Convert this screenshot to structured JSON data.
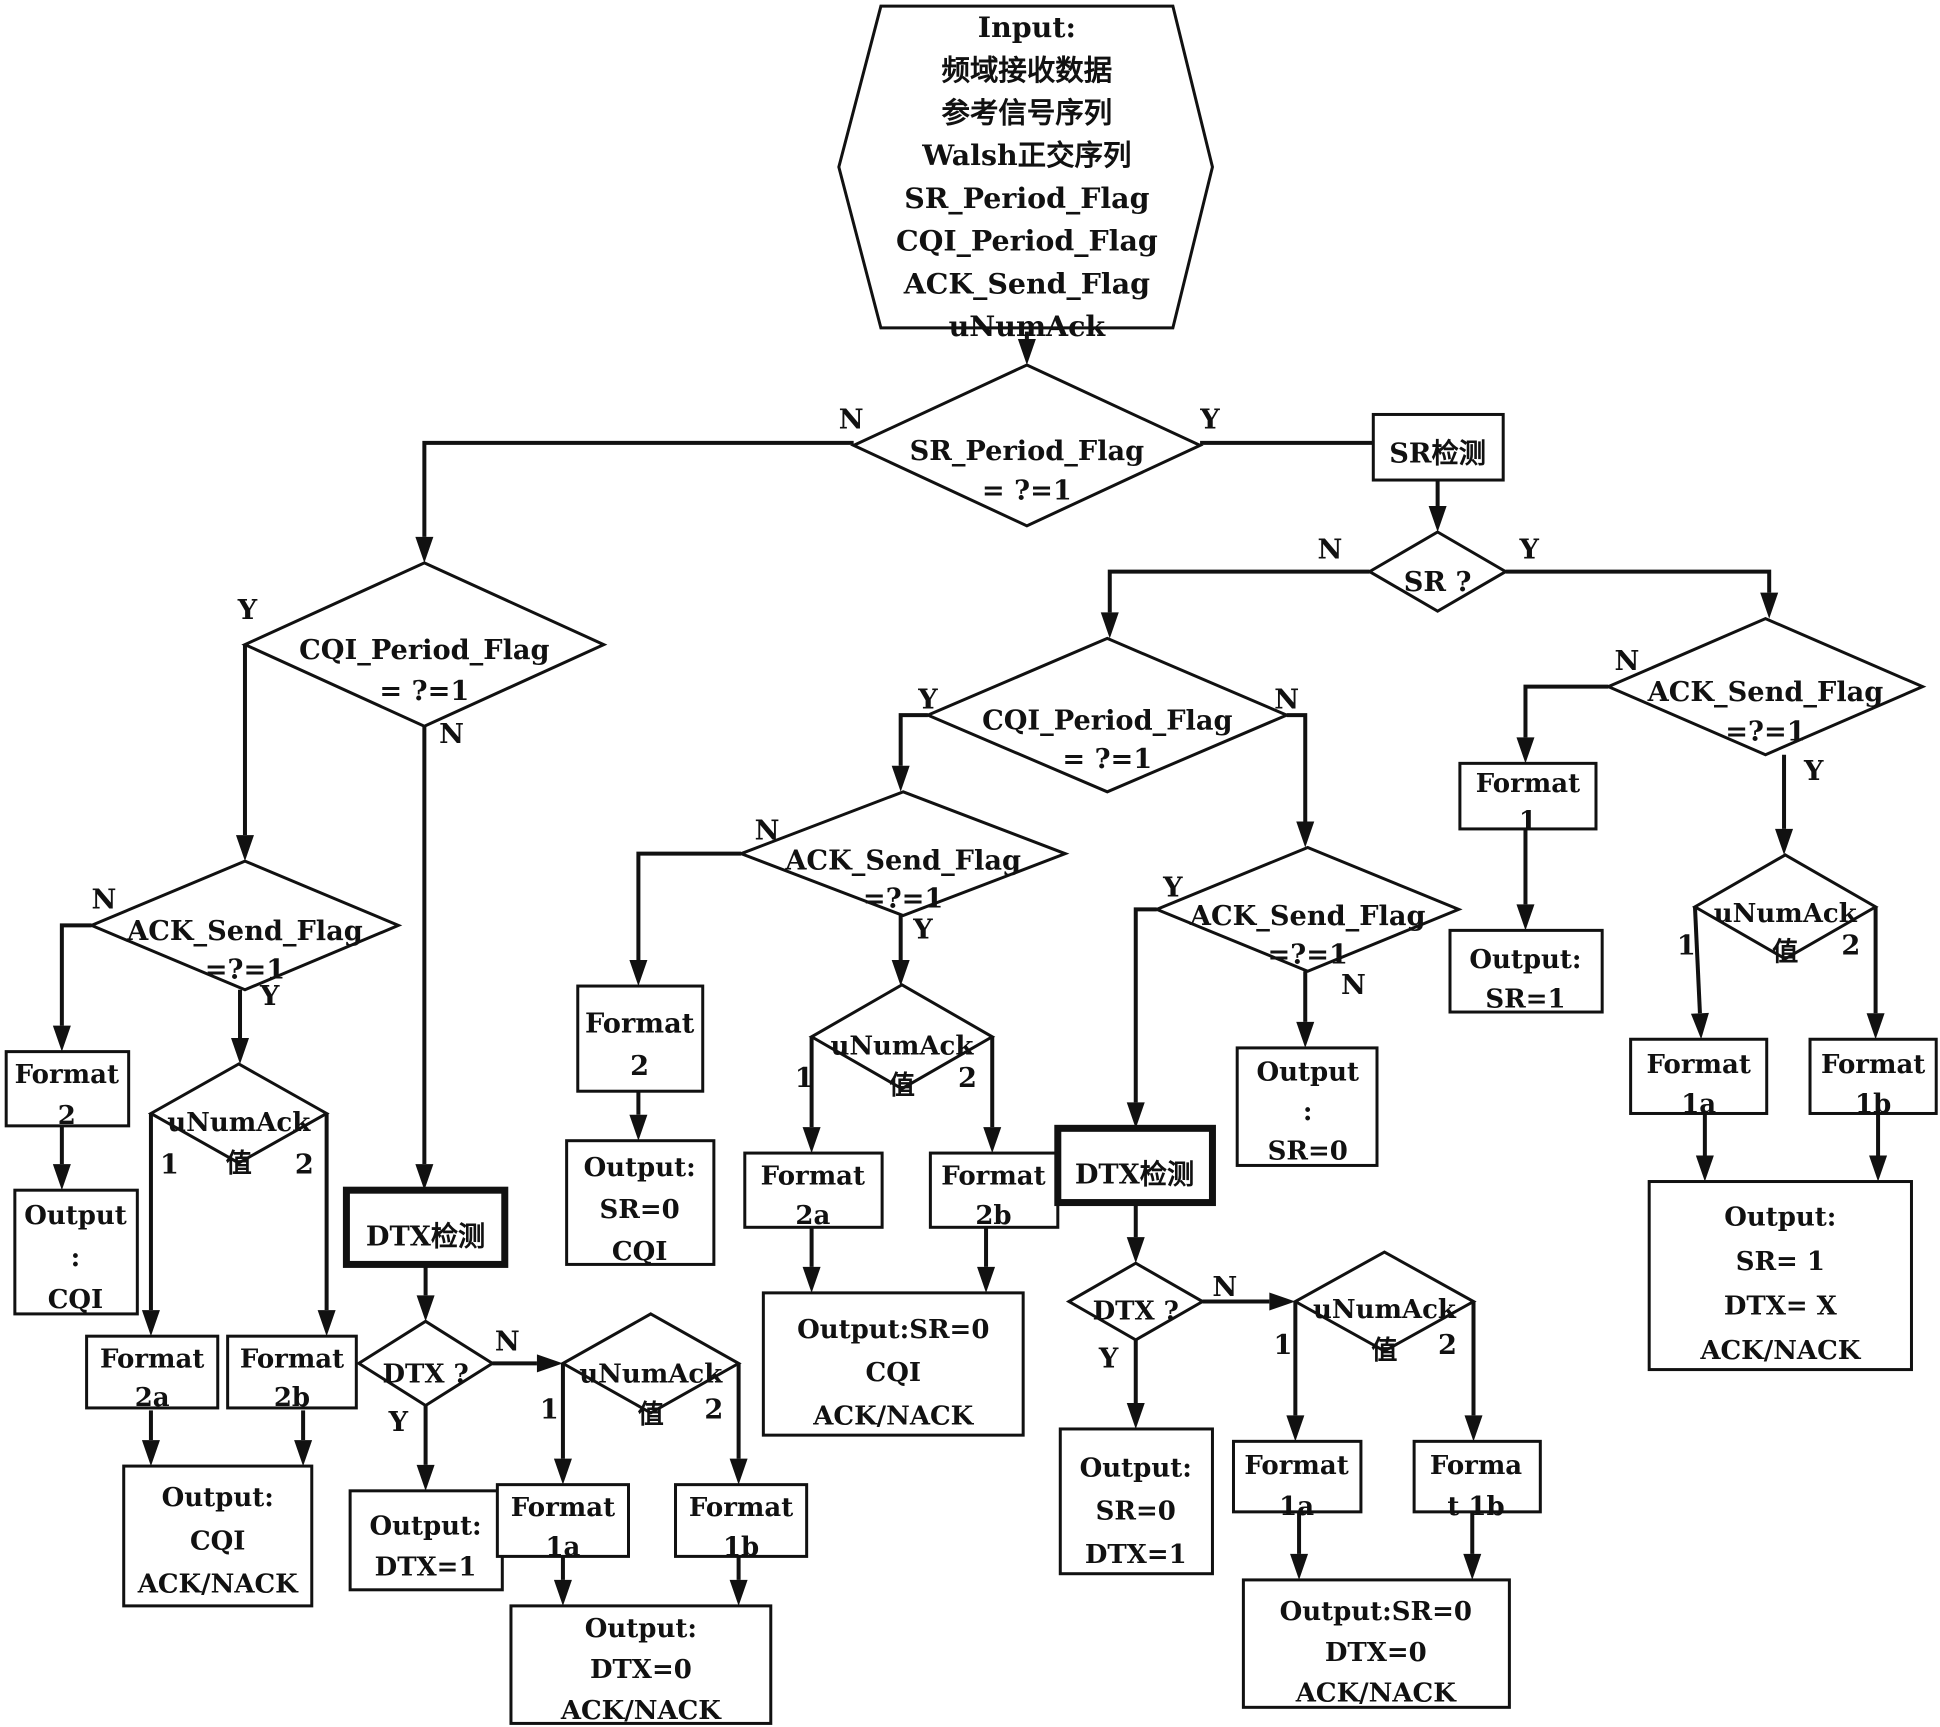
{
  "diagram": {
    "type": "flowchart",
    "language": "zh/en",
    "colors": {
      "ink": "#111111",
      "background": "#ffffff"
    },
    "nodes": {
      "input": {
        "shape": "hexagon",
        "lines": [
          "Input:",
          "频域接收数据",
          "参考信号序列",
          "Walsh正交序列",
          "SR_Period_Flag",
          "CQI_Period_Flag",
          "ACK_Send_Flag",
          "uNumAck"
        ]
      },
      "sr_period_decision": {
        "shape": "decision",
        "lines": [
          "SR_Period_Flag",
          "= ?=1"
        ]
      },
      "sr_detect": {
        "shape": "process",
        "lines": [
          "SR检测"
        ]
      },
      "sr_decision": {
        "shape": "decision",
        "lines": [
          "SR ?"
        ]
      },
      "cqi_decision_left": {
        "shape": "decision",
        "lines": [
          "CQI_Period_Flag",
          "= ?=1"
        ]
      },
      "ack_decision_left": {
        "shape": "decision",
        "lines": [
          "ACK_Send_Flag",
          "=?=1"
        ]
      },
      "format2_left": {
        "shape": "process",
        "lines": [
          "Format",
          "2"
        ]
      },
      "output_cqi_left": {
        "shape": "process",
        "lines": [
          "Output",
          ":",
          "CQI"
        ]
      },
      "unumack_left": {
        "shape": "decision",
        "lines": [
          "uNumAck",
          "值"
        ]
      },
      "format2a_left": {
        "shape": "process",
        "lines": [
          "Format",
          "2a"
        ]
      },
      "format2b_left": {
        "shape": "process",
        "lines": [
          "Format",
          "2b"
        ]
      },
      "output_cqi_acknack_left": {
        "shape": "process",
        "lines": [
          "Output:",
          "CQI",
          "ACK/NACK"
        ]
      },
      "dtx_detect_left": {
        "shape": "process-bold",
        "lines": [
          "DTX检测"
        ]
      },
      "dtx_decision_left": {
        "shape": "decision",
        "lines": [
          "DTX ?"
        ]
      },
      "output_dtx1_left": {
        "shape": "process",
        "lines": [
          "Output:",
          "DTX=1"
        ]
      },
      "unumack_left2": {
        "shape": "decision",
        "lines": [
          "uNumAck",
          "值"
        ]
      },
      "format1a_left": {
        "shape": "process",
        "lines": [
          "Format",
          "1a"
        ]
      },
      "format1b_left": {
        "shape": "process",
        "lines": [
          "Format",
          "1b"
        ]
      },
      "output_dtx0_left": {
        "shape": "process",
        "lines": [
          "Output:",
          "DTX=0",
          "ACK/NACK"
        ]
      },
      "cqi_decision_mid": {
        "shape": "decision",
        "lines": [
          "CQI_Period_Flag",
          "= ?=1"
        ]
      },
      "ack_decision_mid": {
        "shape": "decision",
        "lines": [
          "ACK_Send_Flag",
          "=?=1"
        ]
      },
      "format2_mid": {
        "shape": "process",
        "lines": [
          "Format",
          "2"
        ]
      },
      "output_sr0_cqi_mid": {
        "shape": "process",
        "lines": [
          "Output:",
          "SR=0",
          "CQI"
        ]
      },
      "unumack_mid": {
        "shape": "decision",
        "lines": [
          "uNumAck",
          "值"
        ]
      },
      "format2a_mid": {
        "shape": "process",
        "lines": [
          "Format",
          "2a"
        ]
      },
      "format2b_mid": {
        "shape": "process",
        "lines": [
          "Format",
          "2b"
        ]
      },
      "output_sr0_cqi_acknack_mid": {
        "shape": "process",
        "lines": [
          "Output:SR=0",
          "CQI",
          "ACK/NACK"
        ]
      },
      "ack_decision_mid2": {
        "shape": "decision",
        "lines": [
          "ACK_Send_Flag",
          "=?=1"
        ]
      },
      "output_sr0_mid": {
        "shape": "process",
        "lines": [
          "Output",
          ":",
          "SR=0"
        ]
      },
      "dtx_detect_mid": {
        "shape": "process-bold",
        "lines": [
          "DTX检测"
        ]
      },
      "dtx_decision_mid": {
        "shape": "decision",
        "lines": [
          "DTX ?"
        ]
      },
      "output_sr0_dtx1_mid": {
        "shape": "process",
        "lines": [
          "Output:",
          "SR=0",
          "DTX=1"
        ]
      },
      "unumack_mid2": {
        "shape": "decision",
        "lines": [
          "uNumAck",
          "值"
        ]
      },
      "format1a_mid": {
        "shape": "process",
        "lines": [
          "Format",
          "1a"
        ]
      },
      "format1b_mid": {
        "shape": "process",
        "lines": [
          "Forma",
          "t 1b"
        ]
      },
      "output_sr0_dtx0_mid": {
        "shape": "process",
        "lines": [
          "Output:SR=0",
          "DTX=0",
          "ACK/NACK"
        ]
      },
      "ack_decision_right": {
        "shape": "decision",
        "lines": [
          "ACK_Send_Flag",
          "=?=1"
        ]
      },
      "format1_right": {
        "shape": "process",
        "lines": [
          "Format",
          "1"
        ]
      },
      "output_sr1_right": {
        "shape": "process",
        "lines": [
          "Output:",
          "SR=1"
        ]
      },
      "unumack_right": {
        "shape": "decision",
        "lines": [
          "uNumAck",
          "值"
        ]
      },
      "format1a_right": {
        "shape": "process",
        "lines": [
          "Format",
          "1a"
        ]
      },
      "format1b_right": {
        "shape": "process",
        "lines": [
          "Format",
          "1b"
        ]
      },
      "output_final_right": {
        "shape": "process",
        "lines": [
          "Output:",
          "SR= 1",
          "DTX= X",
          "ACK/NACK"
        ]
      }
    },
    "edges": [
      {
        "from": "input",
        "to": "sr_period_decision",
        "label": ""
      },
      {
        "from": "sr_period_decision",
        "to": "cqi_decision_left",
        "label": "N"
      },
      {
        "from": "sr_period_decision",
        "to": "sr_detect",
        "label": "Y"
      },
      {
        "from": "sr_detect",
        "to": "sr_decision",
        "label": ""
      },
      {
        "from": "sr_decision",
        "to": "cqi_decision_mid",
        "label": "N"
      },
      {
        "from": "sr_decision",
        "to": "ack_decision_right",
        "label": "Y"
      },
      {
        "from": "cqi_decision_left",
        "to": "ack_decision_left",
        "label": "Y"
      },
      {
        "from": "cqi_decision_left",
        "to": "dtx_detect_left",
        "label": "N"
      },
      {
        "from": "ack_decision_left",
        "to": "format2_left",
        "label": "N"
      },
      {
        "from": "ack_decision_left",
        "to": "unumack_left",
        "label": "Y"
      },
      {
        "from": "format2_left",
        "to": "output_cqi_left",
        "label": ""
      },
      {
        "from": "unumack_left",
        "to": "format2a_left",
        "label": "1"
      },
      {
        "from": "unumack_left",
        "to": "format2b_left",
        "label": "2"
      },
      {
        "from": "format2a_left",
        "to": "output_cqi_acknack_left",
        "label": ""
      },
      {
        "from": "format2b_left",
        "to": "output_cqi_acknack_left",
        "label": ""
      },
      {
        "from": "dtx_detect_left",
        "to": "dtx_decision_left",
        "label": ""
      },
      {
        "from": "dtx_decision_left",
        "to": "output_dtx1_left",
        "label": "Y"
      },
      {
        "from": "dtx_decision_left",
        "to": "unumack_left2",
        "label": "N"
      },
      {
        "from": "unumack_left2",
        "to": "format1a_left",
        "label": "1"
      },
      {
        "from": "unumack_left2",
        "to": "format1b_left",
        "label": "2"
      },
      {
        "from": "format1a_left",
        "to": "output_dtx0_left",
        "label": ""
      },
      {
        "from": "format1b_left",
        "to": "output_dtx0_left",
        "label": ""
      },
      {
        "from": "cqi_decision_mid",
        "to": "ack_decision_mid",
        "label": "Y"
      },
      {
        "from": "cqi_decision_mid",
        "to": "ack_decision_mid2",
        "label": "N"
      },
      {
        "from": "ack_decision_mid",
        "to": "format2_mid",
        "label": "N"
      },
      {
        "from": "ack_decision_mid",
        "to": "unumack_mid",
        "label": "Y"
      },
      {
        "from": "format2_mid",
        "to": "output_sr0_cqi_mid",
        "label": ""
      },
      {
        "from": "unumack_mid",
        "to": "format2a_mid",
        "label": "1"
      },
      {
        "from": "unumack_mid",
        "to": "format2b_mid",
        "label": "2"
      },
      {
        "from": "format2a_mid",
        "to": "output_sr0_cqi_acknack_mid",
        "label": ""
      },
      {
        "from": "format2b_mid",
        "to": "output_sr0_cqi_acknack_mid",
        "label": ""
      },
      {
        "from": "ack_decision_mid2",
        "to": "dtx_detect_mid",
        "label": "Y"
      },
      {
        "from": "ack_decision_mid2",
        "to": "output_sr0_mid",
        "label": "N"
      },
      {
        "from": "dtx_detect_mid",
        "to": "dtx_decision_mid",
        "label": ""
      },
      {
        "from": "dtx_decision_mid",
        "to": "output_sr0_dtx1_mid",
        "label": "Y"
      },
      {
        "from": "dtx_decision_mid",
        "to": "unumack_mid2",
        "label": "N"
      },
      {
        "from": "unumack_mid2",
        "to": "format1a_mid",
        "label": "1"
      },
      {
        "from": "unumack_mid2",
        "to": "format1b_mid",
        "label": "2"
      },
      {
        "from": "format1a_mid",
        "to": "output_sr0_dtx0_mid",
        "label": ""
      },
      {
        "from": "format1b_mid",
        "to": "output_sr0_dtx0_mid",
        "label": ""
      },
      {
        "from": "ack_decision_right",
        "to": "format1_right",
        "label": "N"
      },
      {
        "from": "ack_decision_right",
        "to": "unumack_right",
        "label": "Y"
      },
      {
        "from": "format1_right",
        "to": "output_sr1_right",
        "label": ""
      },
      {
        "from": "unumack_right",
        "to": "format1a_right",
        "label": "1"
      },
      {
        "from": "unumack_right",
        "to": "format1b_right",
        "label": "2"
      },
      {
        "from": "format1a_right",
        "to": "output_final_right",
        "label": ""
      },
      {
        "from": "format1b_right",
        "to": "output_final_right",
        "label": ""
      }
    ]
  }
}
